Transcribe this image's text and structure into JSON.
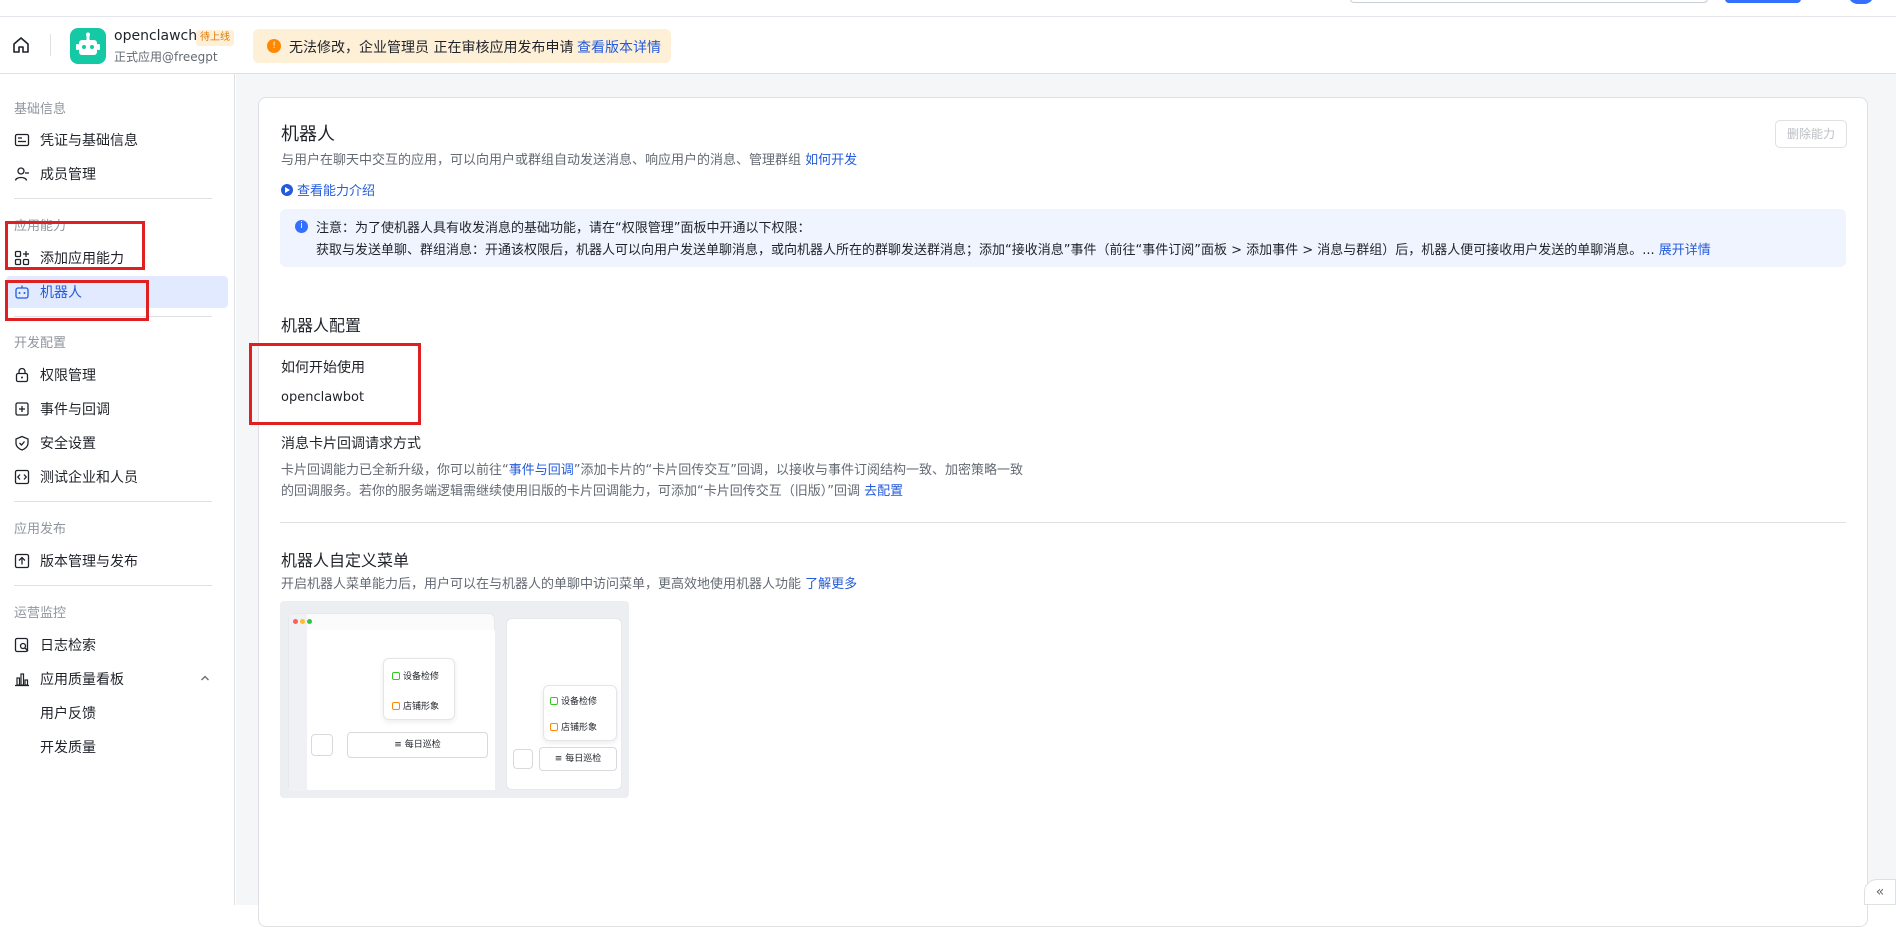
{
  "header": {
    "app_name": "openclawchat",
    "app_tag": "待上线",
    "app_sub": "正式应用@freegpt",
    "notice_text": "无法修改，企业管理员 正在审核应用发布申请",
    "notice_link": "查看版本详情"
  },
  "sidebar": {
    "sec_basic": "基础信息",
    "item_credentials": "凭证与基础信息",
    "item_members": "成员管理",
    "sec_capability": "应用能力",
    "item_add_capability": "添加应用能力",
    "item_bot": "机器人",
    "sec_dev": "开发配置",
    "item_permissions": "权限管理",
    "item_events": "事件与回调",
    "item_security": "安全设置",
    "item_test": "测试企业和人员",
    "sec_release": "应用发布",
    "item_version": "版本管理与发布",
    "sec_ops": "运营监控",
    "item_logs": "日志检索",
    "item_quality": "应用质量看板",
    "item_feedback": "用户反馈",
    "item_dev_quality": "开发质量"
  },
  "main": {
    "title": "机器人",
    "desc": "与用户在聊天中交互的应用，可以向用户或群组自动发送消息、响应用户的消息、管理群组",
    "desc_link": "如何开发",
    "delete_button": "删除能力",
    "intro_link": "查看能力介绍",
    "info_line1": "注意：为了使机器人具有收发消息的基础功能，请在“权限管理”面板中开通以下权限：",
    "info_line2": "获取与发送单聊、群组消息：开通该权限后，机器人可以向用户发送单聊消息，或向机器人所在的群聊发送群消息；添加“接收消息”事件（前往“事件订阅”面板 > 添加事件 > 消息与群组）后，机器人便可接收用户发送的单聊消息。...",
    "info_expand": "展开详情",
    "config_title": "机器人配置",
    "how_to_start": "如何开始使用",
    "bot_name": "openclawbot",
    "card_callback_title": "消息卡片回调请求方式",
    "card_callback_desc1_a": "卡片回调能力已全新升级，你可以前往“",
    "card_callback_desc1_link": "事件与回调",
    "card_callback_desc1_b": "”添加卡片的“卡片回传交互”回调，以接收与事件订阅结构一致、加密策略一致",
    "card_callback_desc2": "的回调服务。若你的服务端逻辑需继续使用旧版的卡片回调能力，可添加“卡片回传交互（旧版）”回调",
    "card_callback_desc2_link": "去配置",
    "menu_title": "机器人自定义菜单",
    "menu_desc": "开启机器人菜单能力后，用户可以在与机器人的单聊中访问菜单，更高效地使用机器人功能",
    "menu_link": "了解更多",
    "preview": {
      "item1": "设备检修",
      "item2": "店铺形象",
      "bar": "每日巡检"
    }
  },
  "colors": {
    "accent": "#3370ff",
    "link": "#245bdb",
    "annotation": "#e02020",
    "notice_bg": "#feefd7"
  }
}
